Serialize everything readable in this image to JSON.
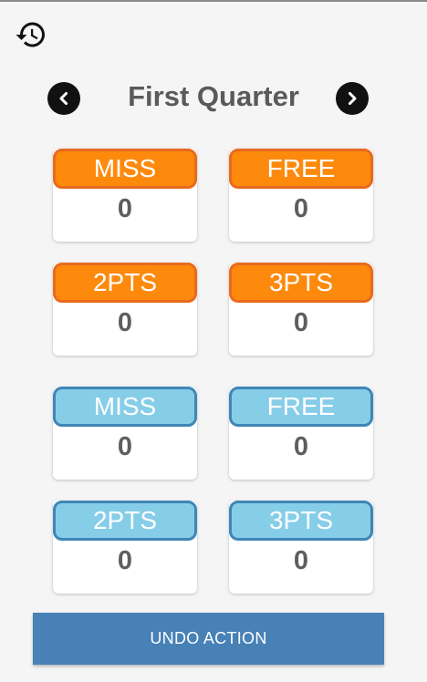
{
  "header": {
    "history_icon": "history-icon"
  },
  "quarter": {
    "title": "First Quarter",
    "prev_icon": "chevron-left-icon",
    "next_icon": "chevron-right-icon"
  },
  "team_orange": {
    "color": "#fd8a0c",
    "cards": [
      {
        "label": "MISS",
        "value": "0"
      },
      {
        "label": "FREE",
        "value": "0"
      },
      {
        "label": "2PTS",
        "value": "0"
      },
      {
        "label": "3PTS",
        "value": "0"
      }
    ]
  },
  "team_blue": {
    "color": "#86cde8",
    "cards": [
      {
        "label": "MISS",
        "value": "0"
      },
      {
        "label": "FREE",
        "value": "0"
      },
      {
        "label": "2PTS",
        "value": "0"
      },
      {
        "label": "3PTS",
        "value": "0"
      }
    ]
  },
  "undo": {
    "label": "UNDO ACTION",
    "color": "#4781b6"
  }
}
